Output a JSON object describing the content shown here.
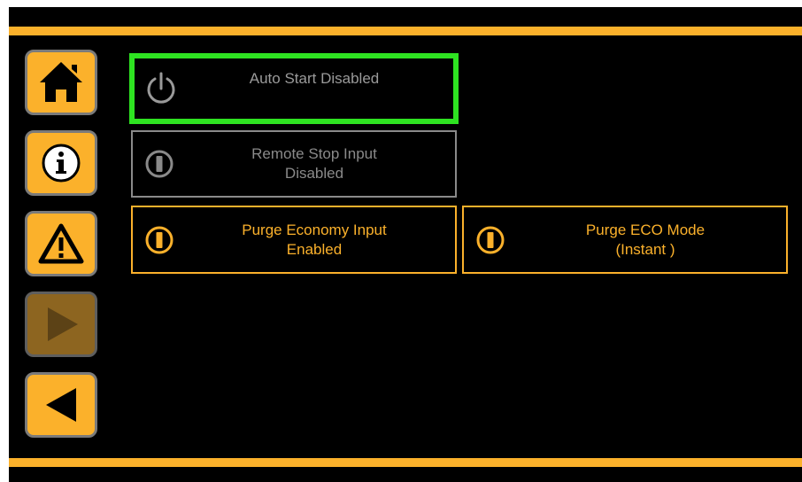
{
  "colors": {
    "accent": "#fbb12b",
    "selected_border": "#2ee321",
    "disabled": "#8a8a8a",
    "background": "#000000"
  },
  "nav": [
    {
      "name": "home",
      "icon": "home-icon",
      "enabled": true
    },
    {
      "name": "info",
      "icon": "info-icon",
      "enabled": true
    },
    {
      "name": "alarms",
      "icon": "warning-icon",
      "enabled": true
    },
    {
      "name": "forward",
      "icon": "play-right-icon",
      "enabled": false
    },
    {
      "name": "back",
      "icon": "back-left-icon",
      "enabled": true
    }
  ],
  "tiles": {
    "auto_start": {
      "line1": "Auto Start Disabled",
      "line2": "",
      "icon": "power-icon",
      "state": "selected"
    },
    "remote_stop": {
      "line1": "Remote Stop Input",
      "line2": "Disabled",
      "icon": "toggle-off-icon",
      "state": "disabled"
    },
    "purge_economy": {
      "line1": "Purge Economy Input",
      "line2": "Enabled",
      "icon": "toggle-on-icon",
      "state": "enabled"
    },
    "purge_eco_mode": {
      "line1": "Purge ECO Mode",
      "line2": "(Instant )",
      "icon": "toggle-on-icon",
      "state": "enabled"
    }
  }
}
